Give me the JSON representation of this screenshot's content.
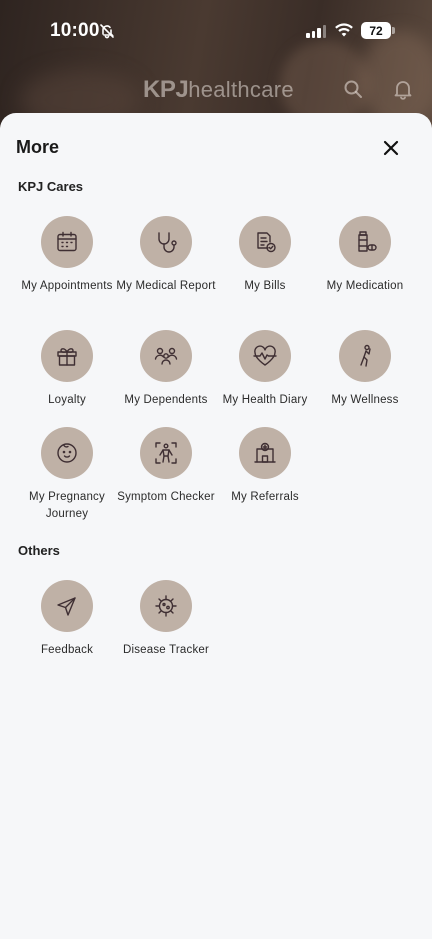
{
  "status_bar": {
    "time": "10:00",
    "battery": "72"
  },
  "app_header": {
    "logo_prefix": "KPJ",
    "logo_suffix": "healthcare"
  },
  "sheet": {
    "title": "More"
  },
  "sections": {
    "kpj_cares": {
      "title": "KPJ Cares",
      "items": [
        {
          "label": "My Appointments",
          "icon": "calendar-icon"
        },
        {
          "label": "My Medical Report",
          "icon": "stethoscope-icon"
        },
        {
          "label": "My Bills",
          "icon": "bill-icon"
        },
        {
          "label": "My Medication",
          "icon": "medication-icon"
        },
        {
          "label": "Loyalty",
          "icon": "gift-icon"
        },
        {
          "label": "My Dependents",
          "icon": "family-icon"
        },
        {
          "label": "My Health Diary",
          "icon": "heartbeat-icon"
        },
        {
          "label": "My Wellness",
          "icon": "exercise-icon"
        },
        {
          "label": "My Pregnancy Journey",
          "icon": "baby-icon"
        },
        {
          "label": "Symptom Checker",
          "icon": "body-scan-icon"
        },
        {
          "label": "My Referrals",
          "icon": "hospital-icon"
        }
      ]
    },
    "others": {
      "title": "Others",
      "items": [
        {
          "label": "Feedback",
          "icon": "send-icon"
        },
        {
          "label": "Disease Tracker",
          "icon": "virus-icon"
        }
      ]
    }
  }
}
